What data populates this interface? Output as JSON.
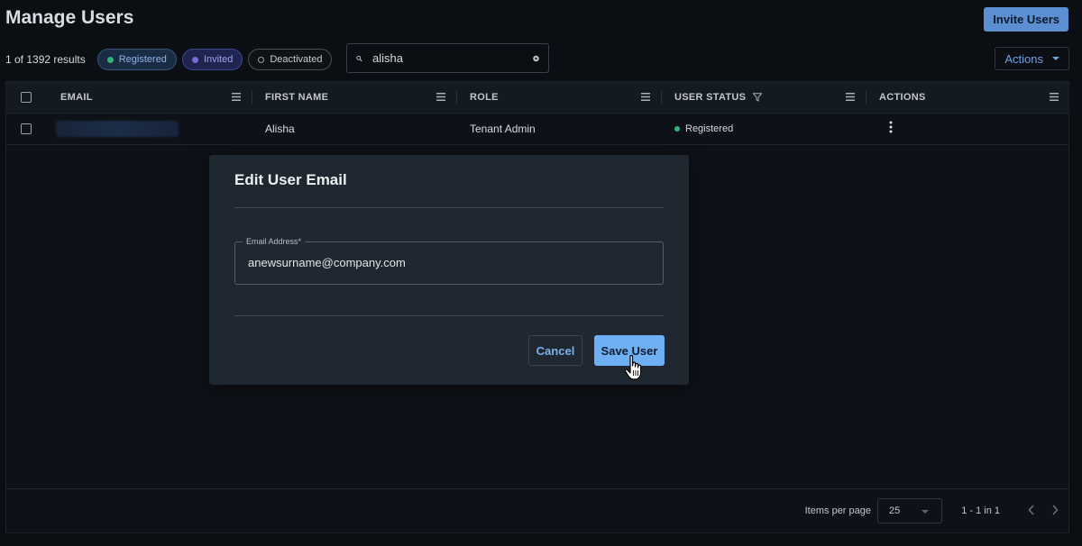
{
  "header": {
    "title": "Manage Users",
    "invite_label": "Invite Users"
  },
  "toolbar": {
    "results": "1 of 1392 results",
    "chips": {
      "registered": "Registered",
      "invited": "Invited",
      "deactivated": "Deactivated"
    },
    "search_value": "alisha",
    "actions_label": "Actions"
  },
  "table": {
    "columns": {
      "email": "EMAIL",
      "first_name": "FIRST NAME",
      "role": "ROLE",
      "user_status": "USER STATUS",
      "actions": "ACTIONS"
    },
    "rows": [
      {
        "first_name": "Alisha",
        "role": "Tenant Admin",
        "status": "Registered"
      }
    ]
  },
  "footer": {
    "items_per_page_label": "Items per page",
    "items_per_page": "25",
    "range": "1 - 1 in 1"
  },
  "modal": {
    "title": "Edit User Email",
    "email_label": "Email Address*",
    "email_value": "anewsurname@company.com",
    "cancel_label": "Cancel",
    "save_label": "Save User"
  },
  "icons": {
    "search": "search-icon",
    "clear": "clear-circle-icon",
    "column_menu": "hamburger-icon",
    "filter": "filter-icon",
    "kebab": "vertical-dots-icon",
    "prev": "chevron-left-icon",
    "next": "chevron-right-icon",
    "cursor": "hand-pointer-icon"
  },
  "colors": {
    "accent": "#6fb0f5",
    "registered": "#2fb47a",
    "invited": "#7a6ad9",
    "background": "#0b0f14",
    "modal": "#1f2831"
  }
}
